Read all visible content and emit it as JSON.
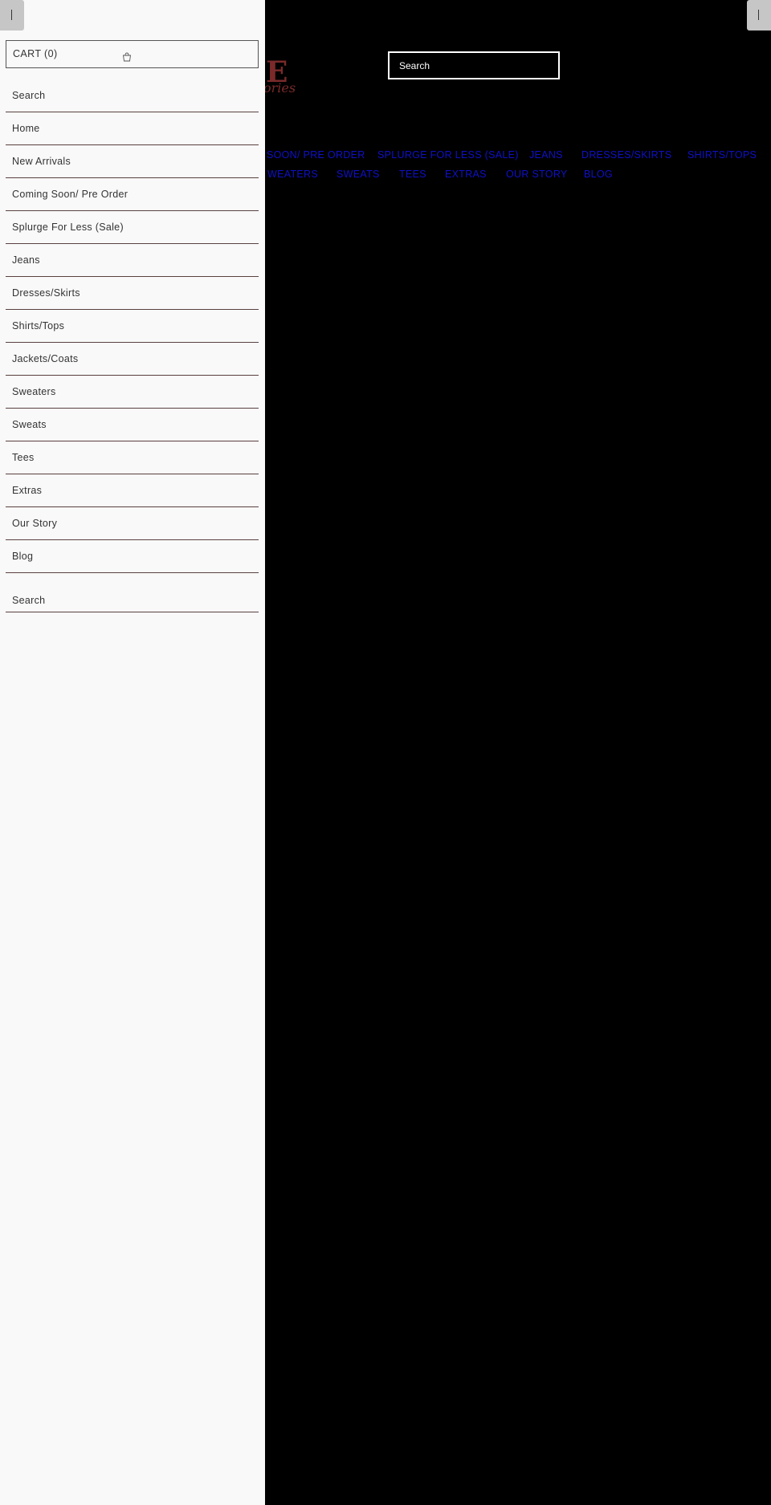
{
  "colors": {
    "drawer_bg": "#f9f9f9",
    "page_bg": "#000000",
    "nav_link": "#1010c8",
    "logo": "#7a2a2a",
    "divider": "#5a4040"
  },
  "drawer": {
    "cart_label": "CART (0)",
    "cart_icon": "shopping-bag-icon",
    "menu_items": [
      "Search",
      "Home",
      "New Arrivals",
      "Coming Soon/ Pre Order",
      "Splurge For Less (Sale)",
      "Jeans",
      "Dresses/Skirts",
      "Shirts/Tops",
      "Jackets/Coats",
      "Sweaters",
      "Sweats",
      "Tees",
      "Extras",
      "Our Story",
      "Blog"
    ],
    "search_placeholder": "Search"
  },
  "header": {
    "logo_top": "E",
    "logo_bottom": "ories",
    "search_placeholder": "Search"
  },
  "nav": {
    "row1": [
      "SOON/ PRE ORDER",
      "SPLURGE FOR LESS (SALE)",
      "JEANS",
      "DRESSES/SKIRTS",
      "SHIRTS/TOPS"
    ],
    "row2": [
      "WEATERS",
      "SWEATS",
      "TEES",
      "EXTRAS",
      "OUR STORY",
      "BLOG"
    ]
  }
}
